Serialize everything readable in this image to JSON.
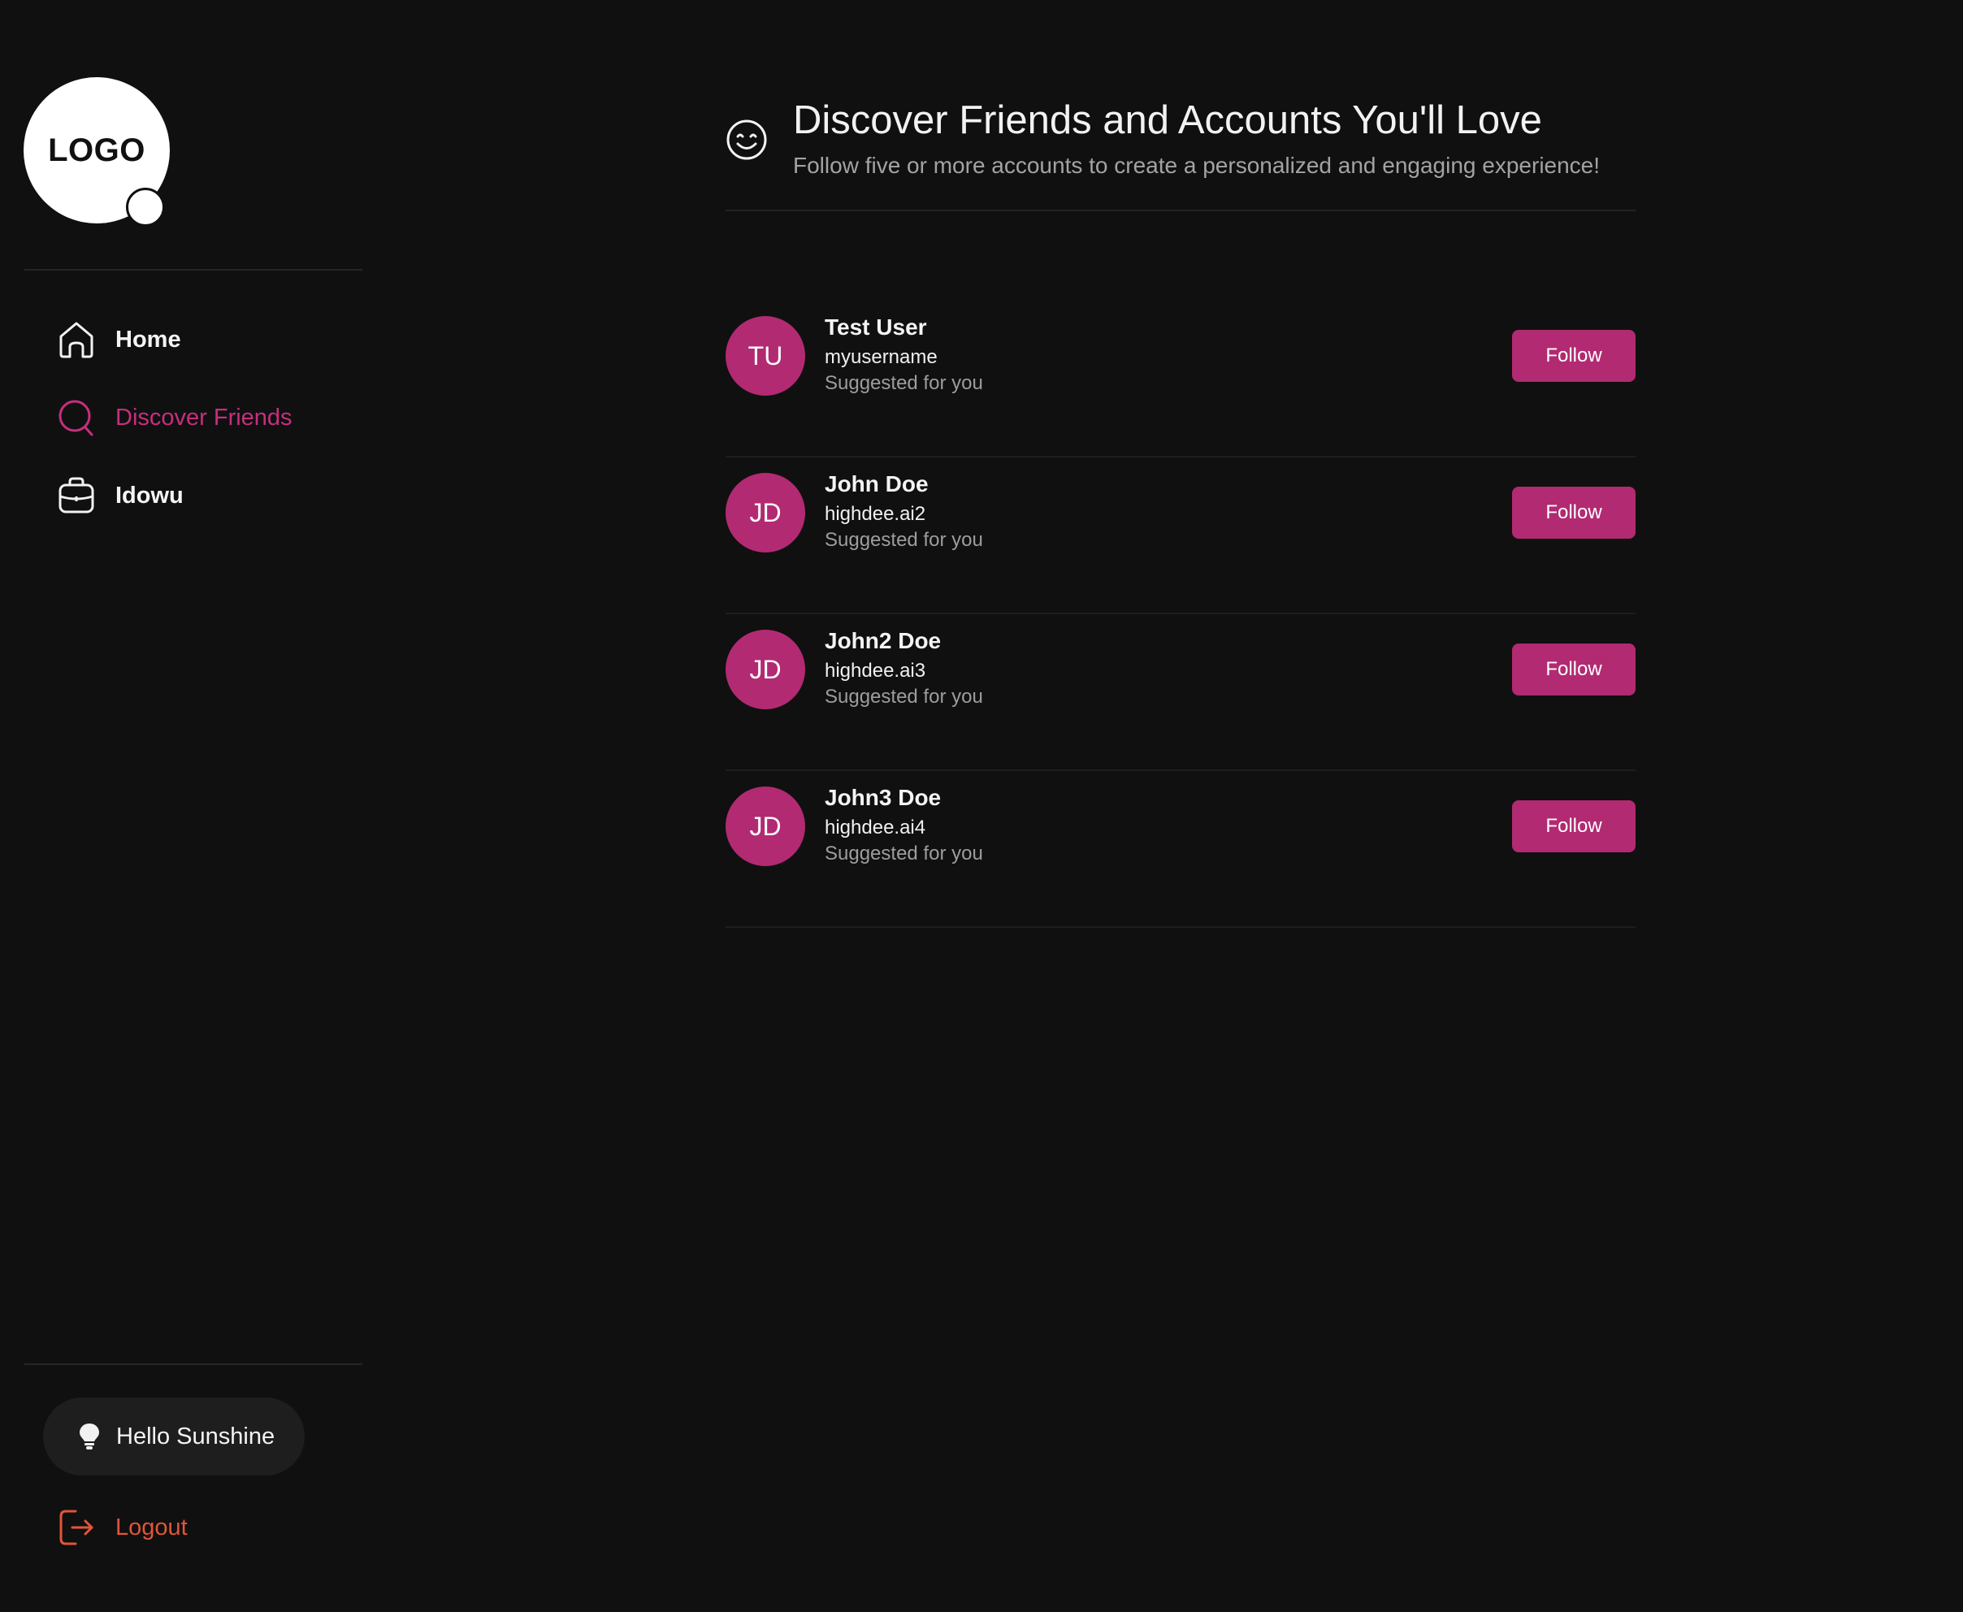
{
  "sidebar": {
    "logo_text": "LOGO",
    "nav": [
      {
        "label": "Home",
        "icon": "home-icon",
        "active": false
      },
      {
        "label": "Discover Friends",
        "icon": "search-icon",
        "active": true
      },
      {
        "label": "Idowu",
        "icon": "briefcase-icon",
        "active": false
      }
    ],
    "hello": {
      "label": "Hello Sunshine",
      "icon": "lightbulb-icon"
    },
    "logout": {
      "label": "Logout",
      "icon": "logout-icon"
    }
  },
  "header": {
    "icon": "smiley-icon",
    "title": "Discover Friends and Accounts You'll Love",
    "subtitle": "Follow five or more accounts to create a personalized and engaging experience!"
  },
  "suggestions": [
    {
      "initials": "TU",
      "name": "Test User",
      "username": "myusername",
      "note": "Suggested for you",
      "action": "Follow"
    },
    {
      "initials": "JD",
      "name": "John Doe",
      "username": "highdee.ai2",
      "note": "Suggested for you",
      "action": "Follow"
    },
    {
      "initials": "JD",
      "name": "John2 Doe",
      "username": "highdee.ai3",
      "note": "Suggested for you",
      "action": "Follow"
    },
    {
      "initials": "JD",
      "name": "John3 Doe",
      "username": "highdee.ai4",
      "note": "Suggested for you",
      "action": "Follow"
    }
  ],
  "colors": {
    "background": "#101010",
    "accent": "#b22a72",
    "active_nav": "#c62f7e",
    "logout": "#e0553a"
  }
}
